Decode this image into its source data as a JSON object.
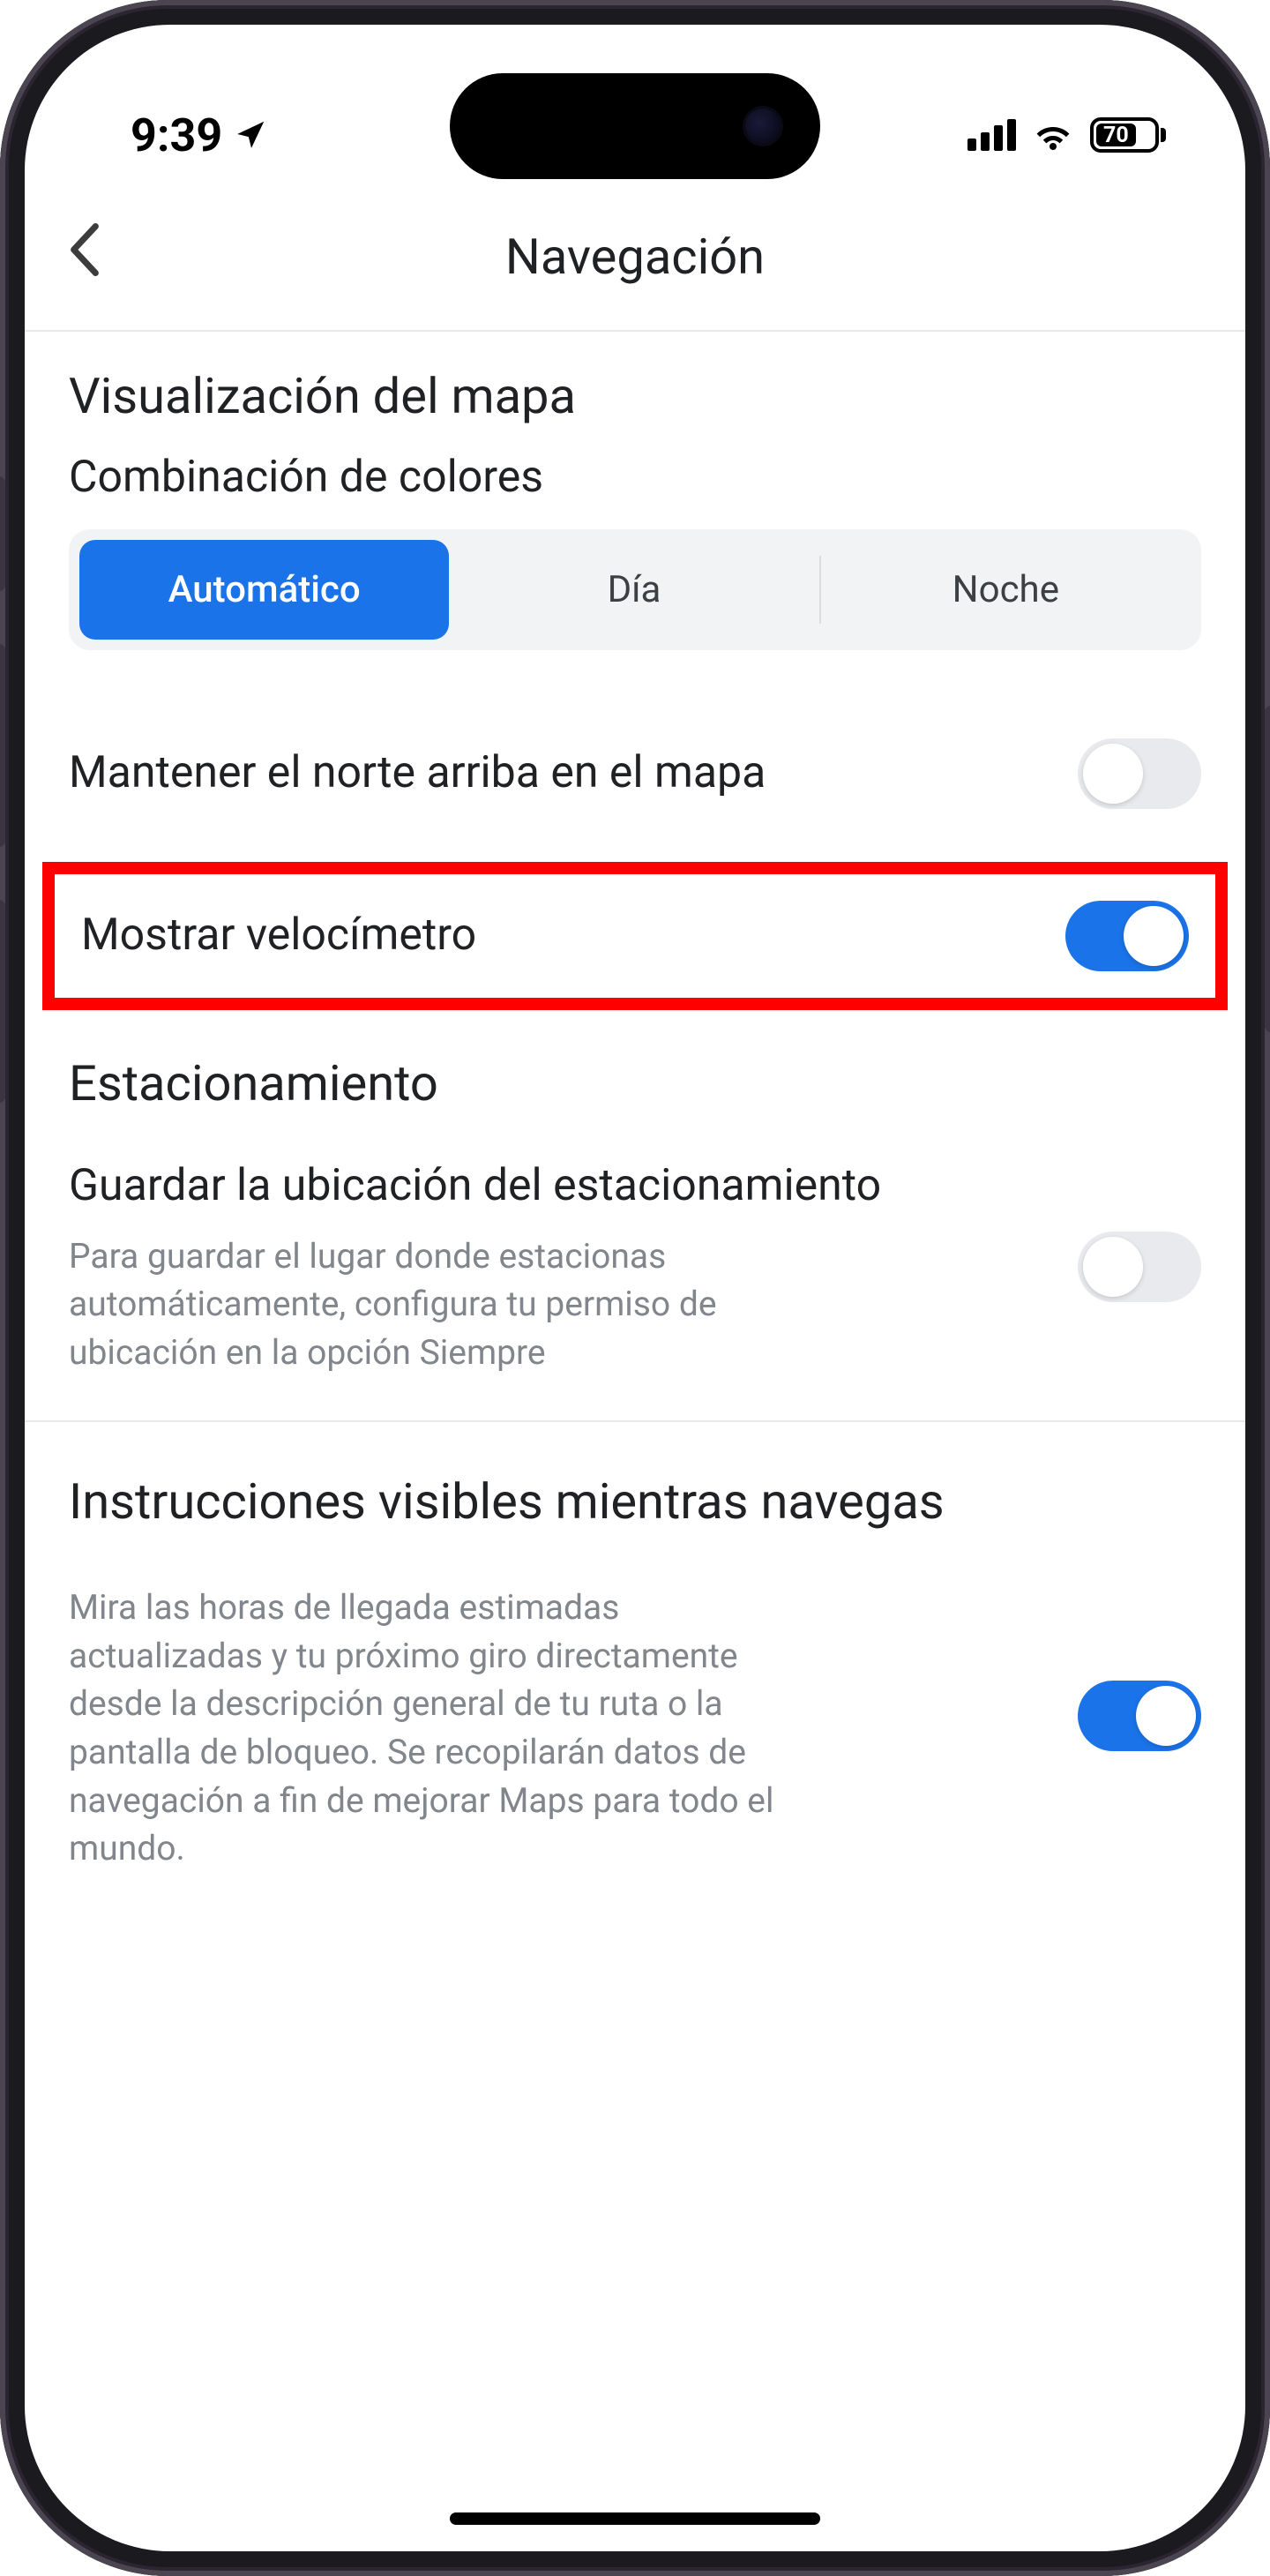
{
  "status": {
    "time": "9:39",
    "battery_pct": "70"
  },
  "header": {
    "title": "Navegación"
  },
  "map_display": {
    "section_title": "Visualización del mapa",
    "color_scheme_label": "Combinación de colores",
    "segments": {
      "auto": "Automático",
      "day": "Día",
      "night": "Noche"
    },
    "north_up_label": "Mantener el norte arriba en el mapa",
    "north_up_on": false,
    "speedometer_label": "Mostrar velocímetro",
    "speedometer_on": true
  },
  "parking": {
    "section_title": "Estacionamiento",
    "save_label": "Guardar la ubicación del estacionamiento",
    "save_desc": "Para guardar el lugar donde estacionas automáticamente, configura tu permiso de ubicación en la opción Siempre",
    "save_on": false
  },
  "live": {
    "section_title": "Instrucciones visibles mientras navegas",
    "desc": "Mira las horas de llegada estimadas actualizadas y tu próximo giro directamente desde la descripción general de tu ruta o la pantalla de bloqueo. Se recopilarán datos de navegación a fin de mejorar Maps para todo el mundo.",
    "on": true
  }
}
